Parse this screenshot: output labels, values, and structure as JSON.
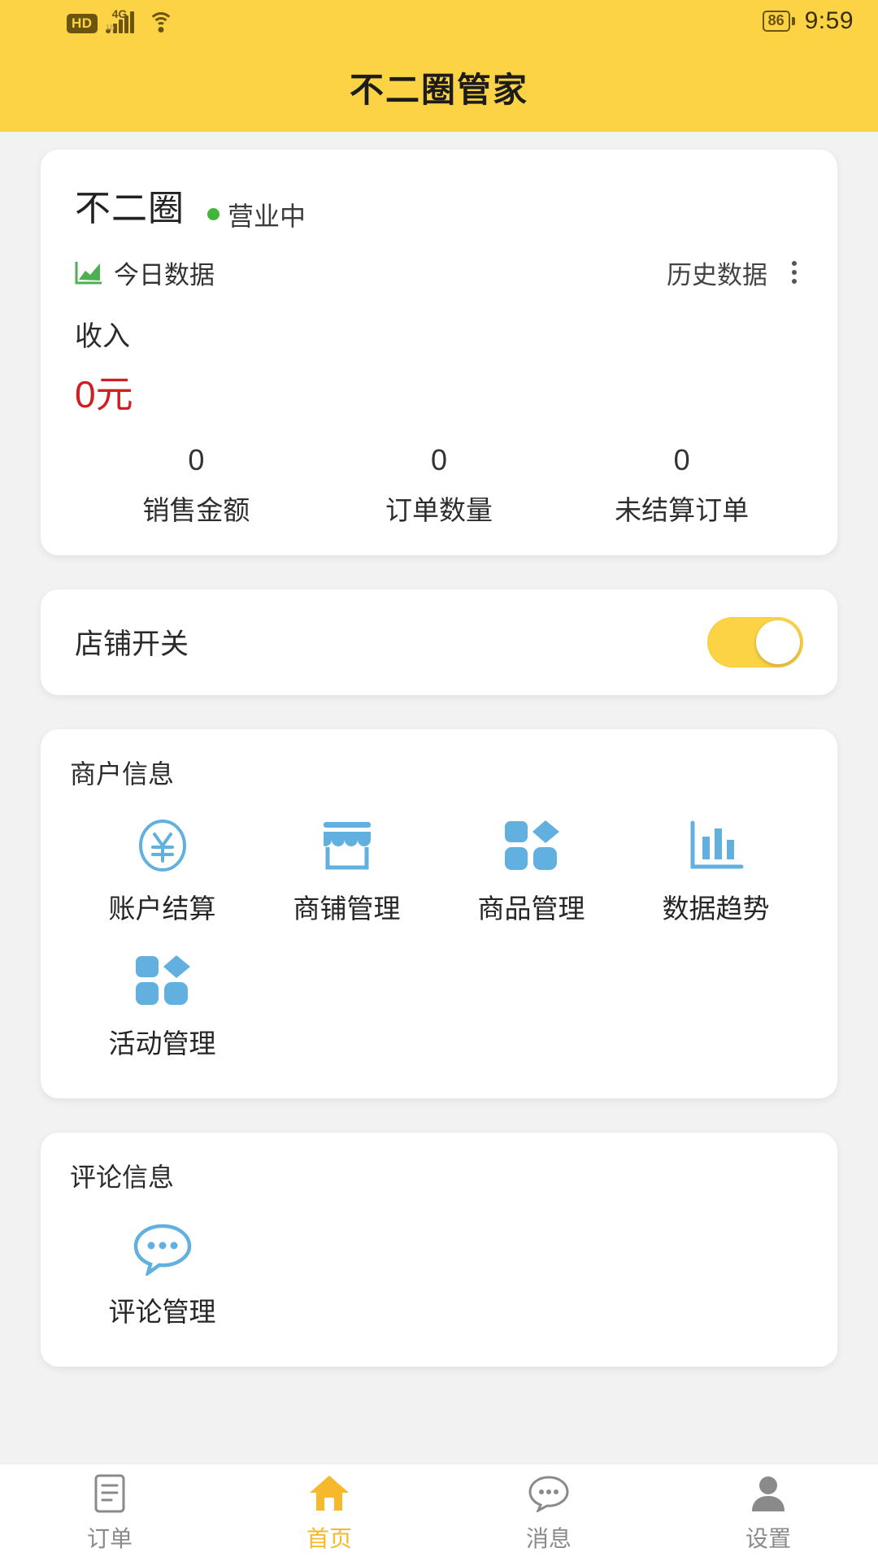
{
  "theme": {
    "brand_yellow": "#fcd344",
    "accent_yellow": "#f5b92b",
    "income_red": "#cf1f22",
    "open_green": "#41b539",
    "icon_blue": "#62b0e0",
    "page_bg": "#f2f2f2"
  },
  "status_bar": {
    "hd_label": "HD",
    "network_label": "4G",
    "network_sub": "1b",
    "wifi_icon": "wifi-icon",
    "battery_level": "86",
    "time": "9:59"
  },
  "header": {
    "title": "不二圈管家"
  },
  "data_card": {
    "shop_name": "不二圈",
    "status_text": "营业中",
    "today_icon": "line-chart-icon",
    "today_label": "今日数据",
    "history_label": "历史数据",
    "more_icon": "kebab-menu-icon",
    "income_label": "收入",
    "income_value": "0元",
    "stats": [
      {
        "value": "0",
        "label": "销售金额"
      },
      {
        "value": "0",
        "label": "订单数量"
      },
      {
        "value": "0",
        "label": "未结算订单"
      }
    ]
  },
  "shop_switch": {
    "label": "店铺开关",
    "state": "on"
  },
  "merchant_section": {
    "title": "商户信息",
    "items": [
      {
        "icon": "yen-circle-icon",
        "label": "账户结算"
      },
      {
        "icon": "storefront-icon",
        "label": "商铺管理"
      },
      {
        "icon": "grid-shapes-icon",
        "label": "商品管理"
      },
      {
        "icon": "bar-chart-icon",
        "label": "数据趋势"
      },
      {
        "icon": "grid-shapes-icon",
        "label": "活动管理"
      }
    ]
  },
  "comment_section": {
    "title": "评论信息",
    "items": [
      {
        "icon": "chat-bubble-icon",
        "label": "评论管理"
      }
    ]
  },
  "tabbar": {
    "active_index": 1,
    "tabs": [
      {
        "icon": "order-list-icon",
        "label": "订单"
      },
      {
        "icon": "home-icon",
        "label": "首页"
      },
      {
        "icon": "message-icon",
        "label": "消息"
      },
      {
        "icon": "settings-user-icon",
        "label": "设置"
      }
    ]
  }
}
